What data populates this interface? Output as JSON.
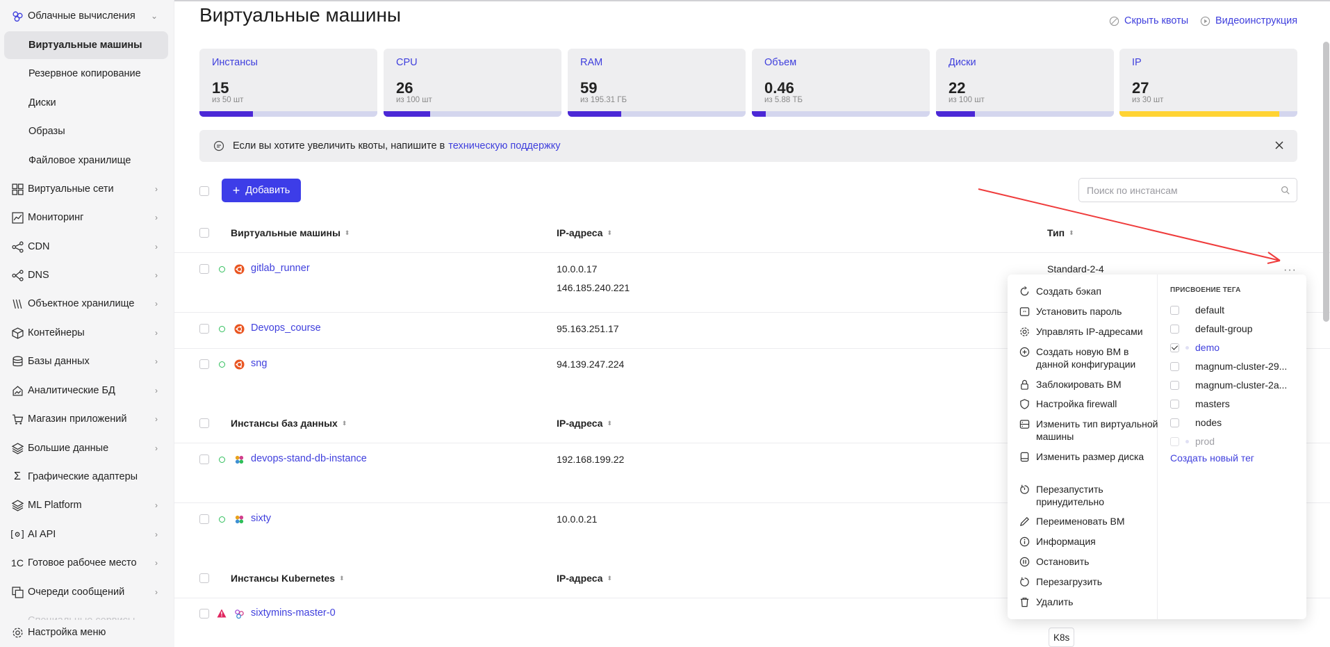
{
  "header": {
    "title": "Виртуальные машины",
    "hide_quotas": "Скрыть квоты",
    "video": "Видеоинструкция"
  },
  "sidebar": {
    "section_open": "Облачные вычисления",
    "sub_items": [
      "Виртуальные машины",
      "Резервное копирование",
      "Диски",
      "Образы",
      "Файловое хранилище"
    ],
    "items": [
      "Виртуальные сети",
      "Мониторинг",
      "CDN",
      "DNS",
      "Объектное хранилище",
      "Контейнеры",
      "Базы данных",
      "Аналитические БД",
      "Магазин приложений",
      "Большие данные",
      "Графические адаптеры",
      "ML Platform",
      "AI API",
      "Готовое рабочее место",
      "Очереди сообщений",
      "Специальные сервисы"
    ],
    "settings": "Настройка меню"
  },
  "quotas": [
    {
      "label": "Инстансы",
      "value": "15",
      "sub": "из 50 шт",
      "fill": 0.3,
      "color": "#4b28d6"
    },
    {
      "label": "CPU",
      "value": "26",
      "sub": "из 100 шт",
      "fill": 0.26,
      "color": "#4b28d6"
    },
    {
      "label": "RAM",
      "value": "59",
      "sub": "из 195.31 ГБ",
      "fill": 0.3,
      "color": "#4b28d6"
    },
    {
      "label": "Объем",
      "value": "0.46",
      "sub": "из 5.88 ТБ",
      "fill": 0.08,
      "color": "#4b28d6"
    },
    {
      "label": "Диски",
      "value": "22",
      "sub": "из 100 шт",
      "fill": 0.22,
      "color": "#4b28d6"
    },
    {
      "label": "IP",
      "value": "27",
      "sub": "из 30 шт",
      "fill": 0.9,
      "color": "#ffd333"
    }
  ],
  "notice": {
    "text": "Если вы хотите увеличить квоты, напишите в",
    "link": "техническую поддержку"
  },
  "toolbar": {
    "add_label": "Добавить",
    "search_placeholder": "Поиск по инстансам"
  },
  "table": {
    "vm_header": "Виртуальные машины",
    "ip_header": "IP-адреса",
    "type_header": "Тип",
    "vms": [
      {
        "name": "gitlab_runner",
        "ips": [
          "10.0.0.17",
          "146.185.240.221"
        ],
        "type": "Standard-2-4"
      },
      {
        "name": "Devops_course",
        "ips": [
          "95.163.251.17"
        ],
        "type": ""
      },
      {
        "name": "sng",
        "ips": [
          "94.139.247.224"
        ],
        "type": ""
      }
    ],
    "db_header": "Инстансы баз данных",
    "db_ip_header": "IP-адреса",
    "dbs": [
      {
        "name": "devops-stand-db-instance",
        "ip": "192.168.199.22"
      },
      {
        "name": "sixty",
        "ip": "10.0.0.21"
      }
    ],
    "k8s_header": "Инстансы Kubernetes",
    "k8s_ip_header": "IP-адреса",
    "k8s": [
      {
        "name": "sixtymins-master-0",
        "type": "K8s"
      }
    ]
  },
  "menu": {
    "actions": [
      "Создать бэкап",
      "Установить пароль",
      "Управлять IP-адресами",
      "Создать новую ВМ в данной конфигурации",
      "Заблокировать ВМ",
      "Настройка firewall",
      "Изменить тип виртуальной машины",
      "Изменить размер диска",
      "Перезапустить принудительно",
      "Переименовать ВМ",
      "Информация",
      "Остановить",
      "Перезагрузить",
      "Удалить"
    ],
    "tag_title": "ПРИСВОЕНИЕ ТЕГА",
    "tags": [
      "default",
      "default-group",
      "demo",
      "magnum-cluster-29...",
      "magnum-cluster-2a...",
      "masters",
      "nodes",
      "prod"
    ],
    "create_tag": "Создать новый тег"
  }
}
